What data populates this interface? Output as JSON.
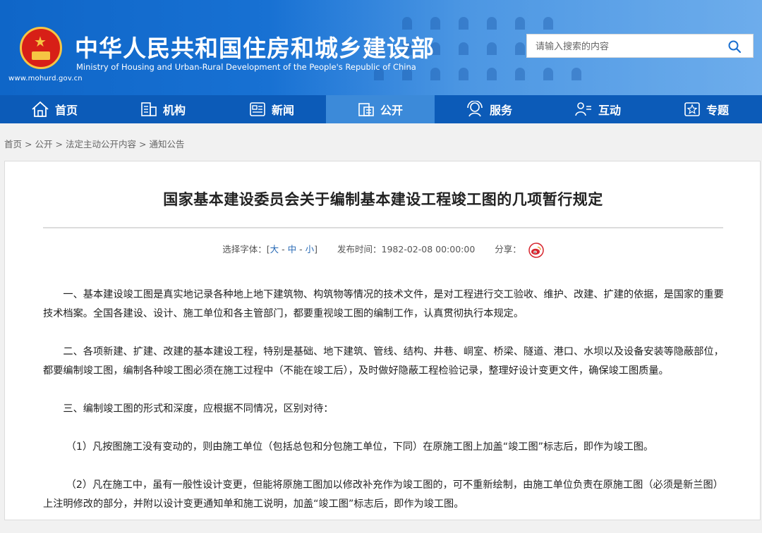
{
  "header": {
    "title": "中华人民共和国住房和城乡建设部",
    "subtitle": "Ministry of Housing and Urban-Rural Development of the People's Republic of China",
    "url": "www.mohurd.gov.cn"
  },
  "search": {
    "placeholder": "请输入搜索的内容",
    "icon": "search-icon"
  },
  "nav": {
    "items": [
      {
        "label": "首页",
        "icon": "home-icon"
      },
      {
        "label": "机构",
        "icon": "building-icon"
      },
      {
        "label": "新闻",
        "icon": "news-icon"
      },
      {
        "label": "公开",
        "icon": "public-icon"
      },
      {
        "label": "服务",
        "icon": "service-icon"
      },
      {
        "label": "互动",
        "icon": "interact-icon"
      },
      {
        "label": "专题",
        "icon": "topic-icon"
      }
    ],
    "active": "公开"
  },
  "breadcrumb": {
    "items": [
      "首页",
      "公开",
      "法定主动公开内容",
      "通知公告"
    ],
    "separator": ">"
  },
  "article": {
    "title": "国家基本建设委员会关于编制基本建设工程竣工图的几项暂行规定",
    "meta": {
      "font_label": "选择字体：",
      "bracket_open": "[",
      "bracket_close": "]",
      "sizes": [
        "大",
        "中",
        "小"
      ],
      "size_sep": " - ",
      "publish_label": "发布时间：",
      "publish_time": "1982-02-08 00:00:00",
      "share_label": "分享：",
      "share_icon": "weibo-icon"
    },
    "paragraphs": [
      "一、基本建设竣工图是真实地记录各种地上地下建筑物、构筑物等情况的技术文件，是对工程进行交工验收、维护、改建、扩建的依据，是国家的重要技术档案。全国各建设、设计、施工单位和各主管部门，都要重视竣工图的编制工作，认真贯彻执行本规定。",
      "二、各项新建、扩建、改建的基本建设工程，特别是基础、地下建筑、管线、结构、井巷、峒室、桥梁、隧道、港口、水坝以及设备安装等隐蔽部位，都要编制竣工图，编制各种竣工图必须在施工过程中（不能在竣工后），及时做好隐蔽工程检验记录，整理好设计变更文件，确保竣工图质量。",
      "三、编制竣工图的形式和深度，应根据不同情况，区别对待：",
      "（1）凡按图施工没有变动的，则由施工单位（包括总包和分包施工单位，下同）在原施工图上加盖“竣工图”标志后，即作为竣工图。",
      "（2）凡在施工中，虽有一般性设计变更，但能将原施工图加以修改补充作为竣工图的，可不重新绘制，由施工单位负责在原施工图（必须是新兰图）上注明修改的部分，并附以设计变更通知单和施工说明，加盖“竣工图”标志后，即作为竣工图。"
    ]
  },
  "colors": {
    "header_blue": "#0f66c8",
    "nav_blue": "#0c5bb8",
    "nav_active": "#3c8ad9",
    "link_blue": "#2769b5",
    "emblem_red": "#d71f17",
    "emblem_gold": "#f6c543"
  }
}
